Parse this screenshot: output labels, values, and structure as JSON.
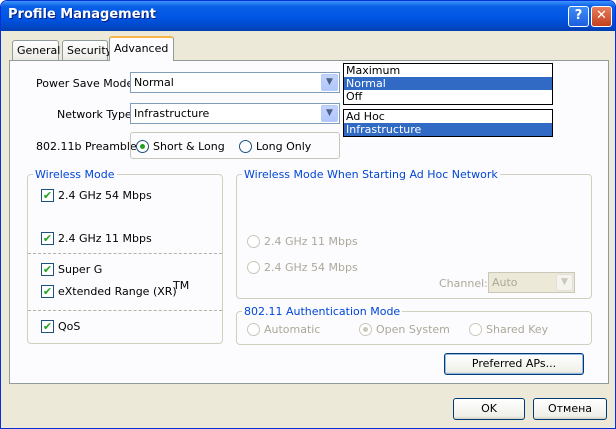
{
  "window": {
    "title": "Profile Management",
    "help_label": "?",
    "close_label": "✕"
  },
  "tabs": [
    {
      "label": "General"
    },
    {
      "label": "Security"
    },
    {
      "label": "Advanced"
    }
  ],
  "power_save": {
    "label": "Power Save Mode:",
    "value": "Normal",
    "options": [
      "Maximum",
      "Normal",
      "Off"
    ],
    "selected": "Normal"
  },
  "network_type": {
    "label": "Network Type:",
    "value": "Infrastructure",
    "options": [
      "Ad Hoc",
      "Infrastructure"
    ],
    "selected": "Infrastructure"
  },
  "preamble": {
    "label": "802.11b Preamble:",
    "short_long": "Short & Long",
    "long_only": "Long Only",
    "selected": "Short & Long"
  },
  "wireless_mode": {
    "title": "Wireless Mode",
    "items": [
      {
        "label": "2.4 GHz 54 Mbps",
        "checked": true
      },
      {
        "label": "2.4 GHz 11 Mbps",
        "checked": true
      },
      {
        "label": "Super G",
        "checked": true
      },
      {
        "label": "eXtended Range (XR)",
        "checked": true
      },
      {
        "label": "QoS",
        "checked": true
      }
    ],
    "tm": "TM"
  },
  "adhoc_mode": {
    "title": "Wireless Mode When Starting Ad Hoc Network",
    "opt_11": "2.4 GHz 11 Mbps",
    "opt_54": "2.4 GHz 54 Mbps",
    "channel_label": "Channel:",
    "channel_value": "Auto"
  },
  "auth_mode": {
    "title": "802.11 Authentication Mode",
    "automatic": "Automatic",
    "open_system": "Open System",
    "shared_key": "Shared Key",
    "selected": "Open System"
  },
  "buttons": {
    "preferred_aps": "Preferred APs...",
    "ok": "OK",
    "cancel": "Отмена"
  },
  "check_glyph": "✔",
  "dropdown_glyph": "▼",
  "colors": {
    "title_bar": "#0055e5",
    "selection": "#316ac5",
    "group_title": "#0046d5",
    "tab_highlight": "#f7b64b"
  }
}
